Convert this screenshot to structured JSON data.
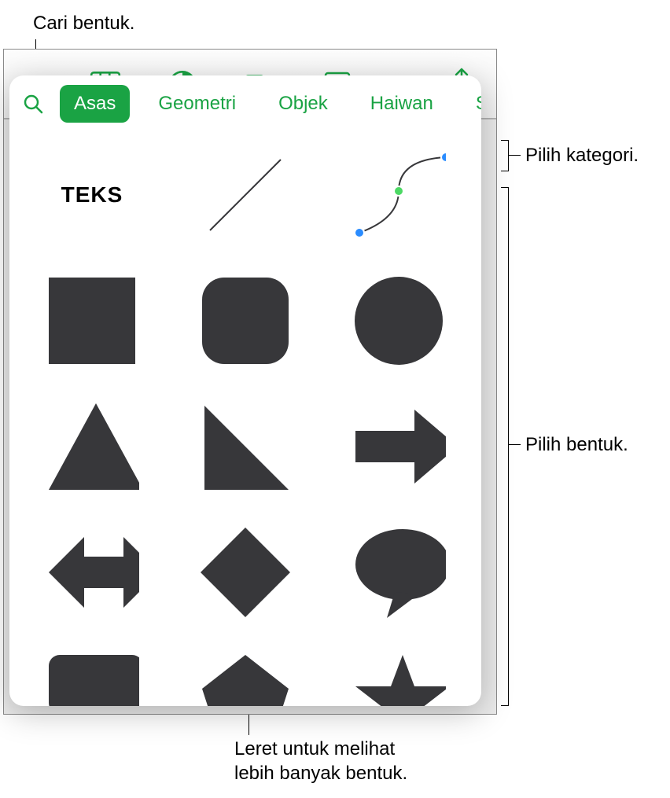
{
  "callouts": {
    "search": "Cari bentuk.",
    "category": "Pilih kategori.",
    "shape": "Pilih bentuk.",
    "swipe": "Leret untuk melihat\nlebih banyak bentuk."
  },
  "toolbar": {
    "table": "table-icon",
    "chart": "chart-icon",
    "shapes": "shapes-icon",
    "media": "media-icon",
    "share": "share-icon"
  },
  "popover": {
    "categories": [
      "Asas",
      "Geometri",
      "Objek",
      "Haiwan",
      "Semua"
    ],
    "active_category": 0,
    "text_shape_label": "TEKS"
  }
}
